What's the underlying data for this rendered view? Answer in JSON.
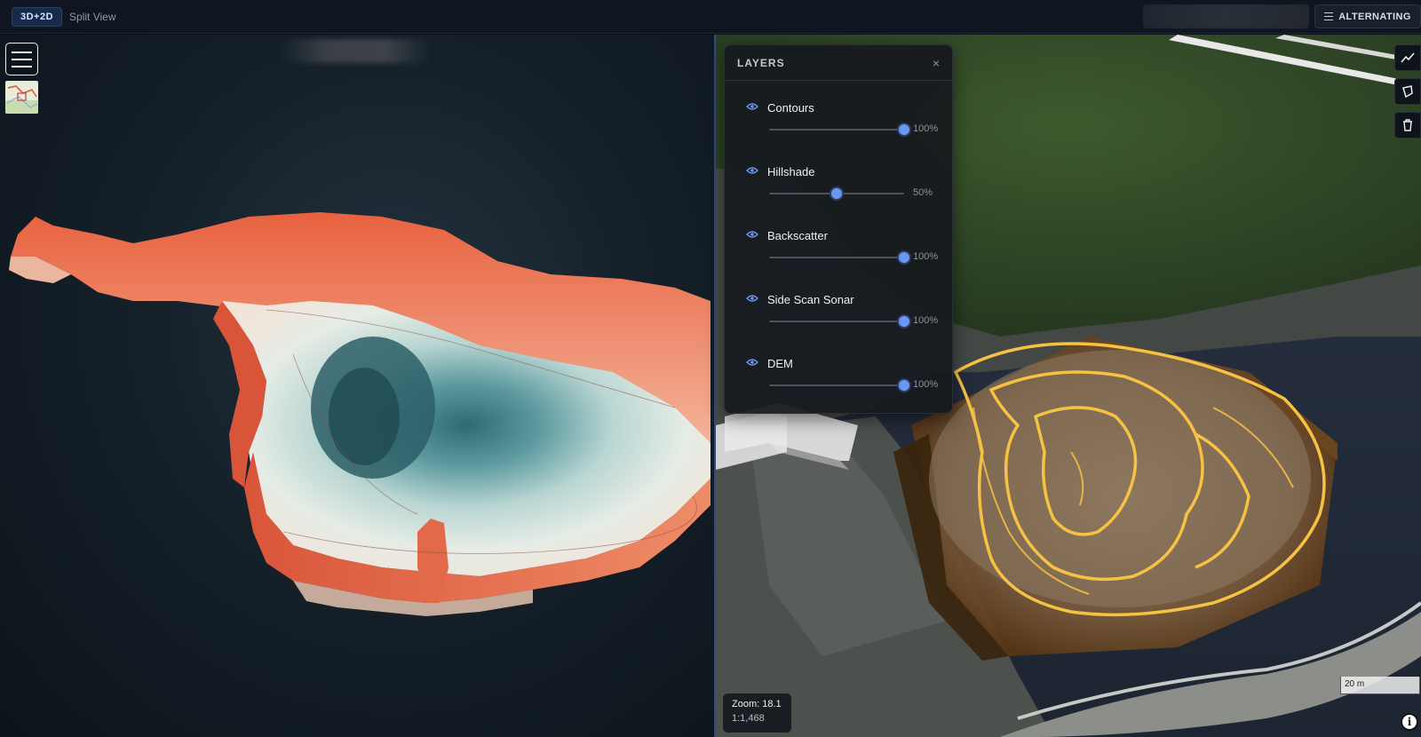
{
  "topbar": {
    "mode_badge": "3D+2D",
    "mode_label": "Split View",
    "alternating_label": "ALTERNATING",
    "alternating_icon": "list-icon"
  },
  "left_pane": {
    "menu_icon": "hamburger-icon",
    "minimap_icon": "minimap-thumbnail"
  },
  "layers_panel": {
    "title": "LAYERS",
    "close_glyph": "×",
    "layers": [
      {
        "name": "Contours",
        "opacity": 100,
        "opacity_label": "100%",
        "visible": true
      },
      {
        "name": "Hillshade",
        "opacity": 50,
        "opacity_label": "50%",
        "visible": true
      },
      {
        "name": "Backscatter",
        "opacity": 100,
        "opacity_label": "100%",
        "visible": true
      },
      {
        "name": "Side Scan Sonar",
        "opacity": 100,
        "opacity_label": "100%",
        "visible": true
      },
      {
        "name": "DEM",
        "opacity": 100,
        "opacity_label": "100%",
        "visible": true
      }
    ]
  },
  "map_tools": [
    {
      "name": "measure-line-icon"
    },
    {
      "name": "draw-polygon-icon"
    },
    {
      "name": "trash-icon"
    }
  ],
  "map_status": {
    "zoom": "Zoom: 18.1",
    "scale": "1:1,468",
    "scale_bar": "20 m",
    "info_glyph": "i"
  },
  "colors": {
    "accent": "#6a98f0",
    "contour": "#f6c244",
    "terrain_high": "#e8623f",
    "terrain_low": "#2f6a72"
  }
}
